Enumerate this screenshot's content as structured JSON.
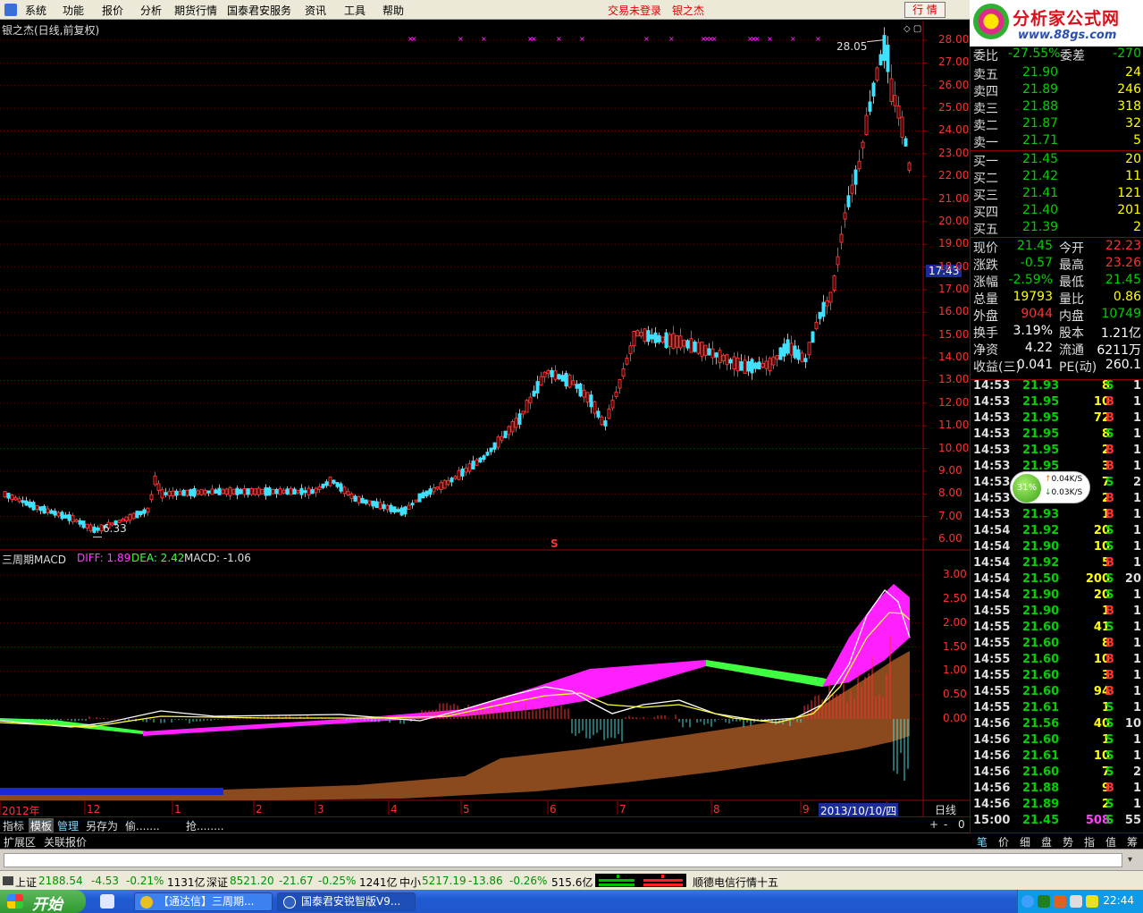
{
  "menu": {
    "items": [
      "系统",
      "功能",
      "报价",
      "分析",
      "期货行情",
      "国泰君安服务",
      "资讯",
      "工具",
      "帮助"
    ],
    "trade_status": "交易未登录",
    "stock_name": "银之杰",
    "quote_button": "行 情"
  },
  "logo": {
    "title": "分析家公式网",
    "url": "www.88gs.com"
  },
  "chart_header": {
    "title": "银之杰(日线,前复权)"
  },
  "indicator": {
    "title": "三周期MACD",
    "diff_label": "DIFF: 1.89",
    "dea_label": "DEA: 2.42",
    "macd_label": "MACD: -1.06"
  },
  "price_annotations": {
    "high_label": "28.05",
    "low_label": "6.33",
    "current_marker": "17.43",
    "s_marker": "S"
  },
  "axis": {
    "price_ticks": [
      "28.00",
      "27.00",
      "26.00",
      "25.00",
      "24.00",
      "23.00",
      "22.00",
      "21.00",
      "20.00",
      "19.00",
      "18.00",
      "17.00",
      "16.00",
      "15.00",
      "14.00",
      "13.00",
      "12.00",
      "11.00",
      "10.00",
      "9.00",
      "8.00",
      "7.00",
      "6.00"
    ],
    "macd_ticks": [
      "3.00",
      "2.50",
      "2.00",
      "1.50",
      "1.00",
      "0.50",
      "0.00"
    ],
    "date_labels": [
      "2012年",
      "12",
      "1",
      "2",
      "3",
      "4",
      "5",
      "6",
      "7",
      "8",
      "9",
      "0"
    ],
    "current_date": "2013/10/10/四",
    "period": "日线"
  },
  "chart_data": {
    "type": "candlestick",
    "title": "银之杰(日线,前复权)",
    "ylim": [
      6.0,
      28.0
    ],
    "x_labels": [
      "2012年",
      "12",
      "1",
      "2",
      "3",
      "4",
      "5",
      "6",
      "7",
      "8",
      "9",
      "0"
    ],
    "high": 28.05,
    "low": 6.33,
    "last": 21.45,
    "macd": {
      "ylim": [
        0.0,
        3.0
      ],
      "diff": 1.89,
      "dea": 2.42,
      "macd": -1.06
    }
  },
  "tabs": {
    "items": [
      "指标",
      "模板",
      "管理",
      "另存为",
      "偷.......",
      "抢........"
    ],
    "extension": "扩展区",
    "related": "关联报价",
    "controls": [
      "+",
      "-",
      "0"
    ]
  },
  "order_book": {
    "weibi_label": "委比",
    "weibi_value": "-27.55%",
    "weicha_label": "委差",
    "weicha_value": "-270",
    "asks": [
      {
        "label": "卖五",
        "price": "21.90",
        "vol": "24"
      },
      {
        "label": "卖四",
        "price": "21.89",
        "vol": "246"
      },
      {
        "label": "卖三",
        "price": "21.88",
        "vol": "318"
      },
      {
        "label": "卖二",
        "price": "21.87",
        "vol": "32"
      },
      {
        "label": "卖一",
        "price": "21.71",
        "vol": "5"
      }
    ],
    "bids": [
      {
        "label": "买一",
        "price": "21.45",
        "vol": "20"
      },
      {
        "label": "买二",
        "price": "21.42",
        "vol": "11"
      },
      {
        "label": "买三",
        "price": "21.41",
        "vol": "121"
      },
      {
        "label": "买四",
        "price": "21.40",
        "vol": "201"
      },
      {
        "label": "买五",
        "price": "21.39",
        "vol": "2"
      }
    ]
  },
  "stats": [
    {
      "l1": "现价",
      "v1": "21.45",
      "l2": "今开",
      "v2": "22.23",
      "c1": "#00d000",
      "c2": "#ff3030"
    },
    {
      "l1": "涨跌",
      "v1": "-0.57",
      "l2": "最高",
      "v2": "23.26",
      "c1": "#00d000",
      "c2": "#ff3030"
    },
    {
      "l1": "涨幅",
      "v1": "-2.59%",
      "l2": "最低",
      "v2": "21.45",
      "c1": "#00d000",
      "c2": "#00d000"
    },
    {
      "l1": "总量",
      "v1": "19793",
      "l2": "量比",
      "v2": "0.86",
      "c1": "#ffff00",
      "c2": "#ffff00"
    },
    {
      "l1": "外盘",
      "v1": "9044",
      "l2": "内盘",
      "v2": "10749",
      "c1": "#ff3030",
      "c2": "#00d000"
    },
    {
      "l1": "换手",
      "v1": "3.19%",
      "l2": "股本",
      "v2": "1.21亿",
      "c1": "#ffffff",
      "c2": "#ffffff"
    },
    {
      "l1": "净资",
      "v1": "4.22",
      "l2": "流通",
      "v2": "6211万",
      "c1": "#ffffff",
      "c2": "#ffffff"
    },
    {
      "l1": "收益(三)",
      "v1": "0.041",
      "l2": "PE(动)",
      "v2": "260.1",
      "c1": "#ffffff",
      "c2": "#ffffff"
    }
  ],
  "ticks": [
    {
      "t": "14:53",
      "p": "21.93",
      "v": "8",
      "s": "S",
      "n": "1"
    },
    {
      "t": "14:53",
      "p": "21.95",
      "v": "10",
      "s": "B",
      "n": "1"
    },
    {
      "t": "14:53",
      "p": "21.95",
      "v": "72",
      "s": "B",
      "n": "1"
    },
    {
      "t": "14:53",
      "p": "21.95",
      "v": "8",
      "s": "S",
      "n": "1"
    },
    {
      "t": "14:53",
      "p": "21.95",
      "v": "2",
      "s": "B",
      "n": "1"
    },
    {
      "t": "14:53",
      "p": "21.95",
      "v": "3",
      "s": "B",
      "n": "1"
    },
    {
      "t": "14:53",
      "p": "21.93",
      "v": "7",
      "s": "S",
      "n": "2"
    },
    {
      "t": "14:53",
      "p": "21.93",
      "v": "2",
      "s": "B",
      "n": "1"
    },
    {
      "t": "14:53",
      "p": "21.93",
      "v": "1",
      "s": "B",
      "n": "1"
    },
    {
      "t": "14:54",
      "p": "21.92",
      "v": "20",
      "s": "S",
      "n": "1"
    },
    {
      "t": "14:54",
      "p": "21.90",
      "v": "10",
      "s": "S",
      "n": "1"
    },
    {
      "t": "14:54",
      "p": "21.92",
      "v": "5",
      "s": "B",
      "n": "1"
    },
    {
      "t": "14:54",
      "p": "21.50",
      "v": "200",
      "s": "S",
      "n": "20"
    },
    {
      "t": "14:54",
      "p": "21.90",
      "v": "20",
      "s": "S",
      "n": "1"
    },
    {
      "t": "14:55",
      "p": "21.90",
      "v": "1",
      "s": "B",
      "n": "1"
    },
    {
      "t": "14:55",
      "p": "21.60",
      "v": "41",
      "s": "S",
      "n": "1"
    },
    {
      "t": "14:55",
      "p": "21.60",
      "v": "8",
      "s": "B",
      "n": "1"
    },
    {
      "t": "14:55",
      "p": "21.60",
      "v": "10",
      "s": "B",
      "n": "1"
    },
    {
      "t": "14:55",
      "p": "21.60",
      "v": "3",
      "s": "B",
      "n": "1"
    },
    {
      "t": "14:55",
      "p": "21.60",
      "v": "94",
      "s": "B",
      "n": "1"
    },
    {
      "t": "14:55",
      "p": "21.61",
      "v": "1",
      "s": "S",
      "n": "1"
    },
    {
      "t": "14:56",
      "p": "21.56",
      "v": "40",
      "s": "S",
      "n": "10"
    },
    {
      "t": "14:56",
      "p": "21.60",
      "v": "1",
      "s": "S",
      "n": "1"
    },
    {
      "t": "14:56",
      "p": "21.61",
      "v": "10",
      "s": "S",
      "n": "1"
    },
    {
      "t": "14:56",
      "p": "21.60",
      "v": "7",
      "s": "S",
      "n": "2"
    },
    {
      "t": "14:56",
      "p": "21.88",
      "v": "9",
      "s": "B",
      "n": "1"
    },
    {
      "t": "14:56",
      "p": "21.89",
      "v": "2",
      "s": "S",
      "n": "1"
    },
    {
      "t": "15:00",
      "p": "21.45",
      "v": "508",
      "s": "S",
      "n": "55"
    }
  ],
  "speed_widget": {
    "percent": "31%",
    "up": "0.04K/S",
    "down": "0.03K/S"
  },
  "panel_tabs": [
    "笔",
    "价",
    "细",
    "盘",
    "势",
    "指",
    "值",
    "筹"
  ],
  "index_bar": {
    "sh_label": "上证",
    "sh_value": "2188.54",
    "sh_change": "-4.53",
    "sh_pct": "-0.21%",
    "sh_amt": "1131亿",
    "sz_label": "深证",
    "sz_value": "8521.20",
    "sz_change": "-21.67",
    "sz_pct": "-0.25%",
    "sz_amt": "1241亿",
    "zx_label": "中小",
    "zx_value": "5217.19",
    "zx_change": "-13.86",
    "zx_pct": "-0.26%",
    "zx_amt": "515.6亿",
    "ticker": "顺德电信行情十五"
  },
  "taskbar": {
    "start": "开始",
    "task1": "【通达信】三周期...",
    "task2": "国泰君安锐智版V9...",
    "clock": "22:44"
  }
}
